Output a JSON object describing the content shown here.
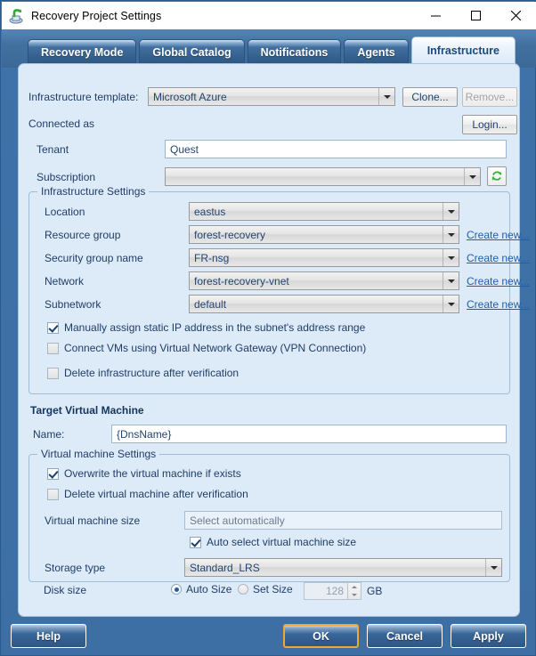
{
  "window": {
    "title": "Recovery Project Settings",
    "app_icon": "recovery-app-icon",
    "minimize": "—",
    "maximize": "□",
    "close": "✕"
  },
  "tabs": [
    {
      "label": "Recovery Mode",
      "active": false
    },
    {
      "label": "Global Catalog",
      "active": false
    },
    {
      "label": "Notifications",
      "active": false
    },
    {
      "label": "Agents",
      "active": false
    },
    {
      "label": "Infrastructure",
      "active": true
    }
  ],
  "template_row": {
    "label": "Infrastructure template:",
    "value": "Microsoft Azure",
    "clone_button": "Clone...",
    "remove_button": "Remove..."
  },
  "connection": {
    "connected_as_label": "Connected as",
    "login_button": "Login...",
    "tenant_label": "Tenant",
    "tenant_value": "Quest",
    "subscription_label": "Subscription",
    "subscription_value": "",
    "refresh_icon": "refresh-icon"
  },
  "infrastructure_settings": {
    "title": "Infrastructure Settings",
    "rows": [
      {
        "label": "Location",
        "value": "eastus",
        "link": ""
      },
      {
        "label": "Resource group",
        "value": "forest-recovery",
        "link": "Create new..."
      },
      {
        "label": "Security group name",
        "value": "FR-nsg",
        "link": "Create new..."
      },
      {
        "label": "Network",
        "value": "forest-recovery-vnet",
        "link": "Create new..."
      },
      {
        "label": "Subnetwork",
        "value": "default",
        "link": "Create new..."
      }
    ],
    "checkboxes": [
      {
        "label": "Manually assign static IP address in the subnet's address range",
        "checked": true
      },
      {
        "label": "Connect VMs using Virtual Network Gateway (VPN Connection)",
        "checked": false
      },
      {
        "label": "Delete infrastructure after verification",
        "checked": false
      }
    ]
  },
  "target_vm": {
    "heading": "Target Virtual Machine",
    "name_label": "Name:",
    "name_value": "{DnsName}"
  },
  "vm_settings": {
    "title": "Virtual machine Settings",
    "checkboxes": [
      {
        "label": "Overwrite the virtual machine if exists",
        "checked": true
      },
      {
        "label": "Delete virtual machine after verification",
        "checked": false
      }
    ],
    "size_label": "Virtual machine size",
    "size_value": "Select automatically",
    "auto_select_label": "Auto select virtual machine size",
    "auto_select_checked": true,
    "storage_label": "Storage type",
    "storage_value": "Standard_LRS",
    "disk_label": "Disk size",
    "disk_auto_label": "Auto Size",
    "disk_set_label": "Set Size",
    "disk_auto_selected": true,
    "disk_size_value": "128",
    "disk_unit": "GB"
  },
  "footer": {
    "help": "Help",
    "ok": "OK",
    "cancel": "Cancel",
    "apply": "Apply"
  },
  "colors": {
    "frame_blue": "#3d6fa4",
    "panel_bg": "#ddeaf8",
    "label_blue": "#1f3d66",
    "link_blue": "#1f5fa8",
    "default_button_focus": "#f0a830",
    "refresh_green": "#33b233"
  }
}
